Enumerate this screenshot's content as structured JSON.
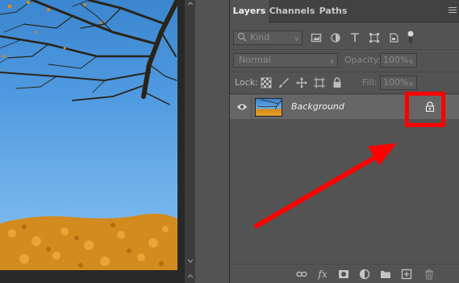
{
  "tabs": [
    {
      "label": "Layers",
      "active": true
    },
    {
      "label": "Channels",
      "active": false
    },
    {
      "label": "Paths",
      "active": false
    }
  ],
  "filter": {
    "placeholder": "Kind",
    "icons": [
      "search-icon",
      "image-filter-icon",
      "adjustment-filter-icon",
      "type-filter-icon",
      "shape-filter-icon",
      "smart-object-filter-icon",
      "filter-toggle"
    ]
  },
  "blend": {
    "mode": "Normal",
    "opacity_label": "Opacity:",
    "opacity_value": "100%"
  },
  "lock": {
    "label": "Lock:",
    "fill_label": "Fill:",
    "fill_value": "100%",
    "icons": [
      "lock-transparent-icon",
      "lock-pixels-icon",
      "lock-position-icon",
      "lock-artboard-icon",
      "lock-all-icon"
    ]
  },
  "layers": [
    {
      "name": "Background",
      "visible": true,
      "locked": true
    }
  ],
  "bottom_icons": [
    "link-layers-icon",
    "fx-icon",
    "add-mask-icon",
    "adjustment-layer-icon",
    "new-group-icon",
    "new-layer-icon",
    "delete-layer-icon"
  ],
  "bottom_labels": {
    "fx": "fx"
  },
  "colors": {
    "highlight": "#ff0000",
    "panel_bg": "#535353",
    "selected_layer": "#666666"
  }
}
